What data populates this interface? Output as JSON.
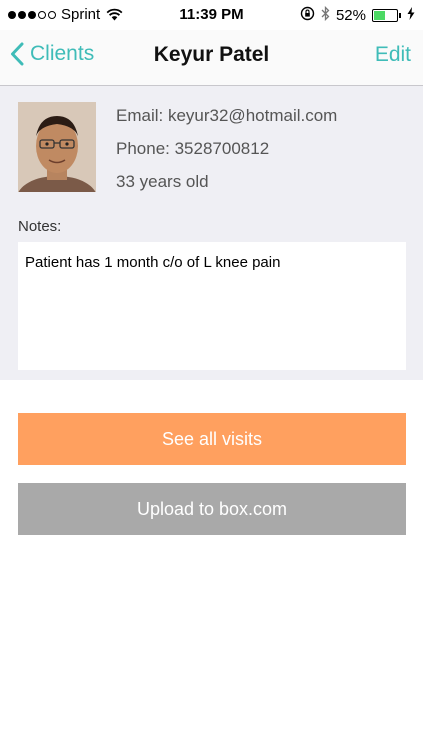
{
  "status_bar": {
    "carrier": "Sprint",
    "time": "11:39 PM",
    "battery_percent": "52%",
    "battery_level": 0.52,
    "signal_bars_filled": 3,
    "signal_bars_total": 5
  },
  "nav": {
    "back_label": "Clients",
    "title": "Keyur Patel",
    "edit_label": "Edit",
    "accent_color": "#3fbcb8"
  },
  "profile": {
    "email": "Email: keyur32@hotmail.com",
    "phone": "Phone: 3528700812",
    "age": "33 years old"
  },
  "notes": {
    "label": "Notes:",
    "text": "Patient has 1 month c/o of L knee pain"
  },
  "actions": {
    "see_visits_label": "See all visits",
    "see_visits_color": "#ffa05f",
    "upload_label": "Upload to box.com",
    "upload_color": "#a9a9a9"
  }
}
